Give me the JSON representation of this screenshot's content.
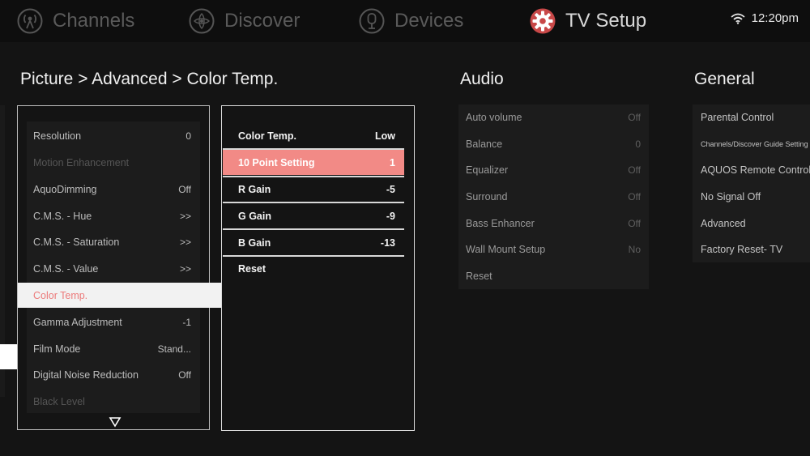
{
  "nav": {
    "items": [
      {
        "label": "Channels",
        "icon": "channels-icon"
      },
      {
        "label": "Discover",
        "icon": "discover-icon"
      },
      {
        "label": "Devices",
        "icon": "devices-icon"
      },
      {
        "label": "TV Setup",
        "icon": "tv-setup-icon"
      }
    ],
    "active": "TV Setup",
    "time": "12:20pm"
  },
  "breadcrumb": "Picture > Advanced > Color Temp.",
  "picture_menu": {
    "items": [
      {
        "label": "Resolution",
        "value": "0"
      },
      {
        "label": "Motion Enhancement",
        "value": "",
        "disabled": true
      },
      {
        "label": "AquoDimming",
        "value": "Off"
      },
      {
        "label": "C.M.S. - Hue",
        "value": ">>"
      },
      {
        "label": "C.M.S. - Saturation",
        "value": ">>"
      },
      {
        "label": "C.M.S. - Value",
        "value": ">>"
      },
      {
        "label": "Color Temp.",
        "value": "",
        "selected": true
      },
      {
        "label": "Gamma Adjustment",
        "value": "-1"
      },
      {
        "label": "Film Mode",
        "value": "Stand..."
      },
      {
        "label": "Digital Noise Reduction",
        "value": "Off"
      },
      {
        "label": "Black Level",
        "value": "",
        "disabled": true
      }
    ]
  },
  "color_temp_menu": {
    "items": [
      {
        "label": "Color Temp.",
        "value": "Low"
      },
      {
        "label": "10 Point Setting",
        "value": "1",
        "selected": true
      },
      {
        "label": "R Gain",
        "value": "-5"
      },
      {
        "label": "G Gain",
        "value": "-9"
      },
      {
        "label": "B Gain",
        "value": "-13"
      },
      {
        "label": "Reset",
        "value": ""
      }
    ]
  },
  "audio": {
    "title": "Audio",
    "items": [
      {
        "label": "Auto volume",
        "value": "Off"
      },
      {
        "label": "Balance",
        "value": "0"
      },
      {
        "label": "Equalizer",
        "value": "Off"
      },
      {
        "label": "Surround",
        "value": "Off"
      },
      {
        "label": "Bass Enhancer",
        "value": "Off"
      },
      {
        "label": "Wall Mount Setup",
        "value": "No"
      },
      {
        "label": "Reset",
        "value": ""
      }
    ]
  },
  "general": {
    "title": "General",
    "items": [
      {
        "label": "Parental Control"
      },
      {
        "label": "Channels/Discover Guide Setting"
      },
      {
        "label": "AQUOS Remote Control"
      },
      {
        "label": "No Signal Off"
      },
      {
        "label": "Advanced"
      },
      {
        "label": "Factory Reset- TV"
      }
    ]
  },
  "colors": {
    "background": "#141414",
    "highlight": "#f28a86",
    "selected_text": "#ec7b7b",
    "gear": "#c84848"
  }
}
